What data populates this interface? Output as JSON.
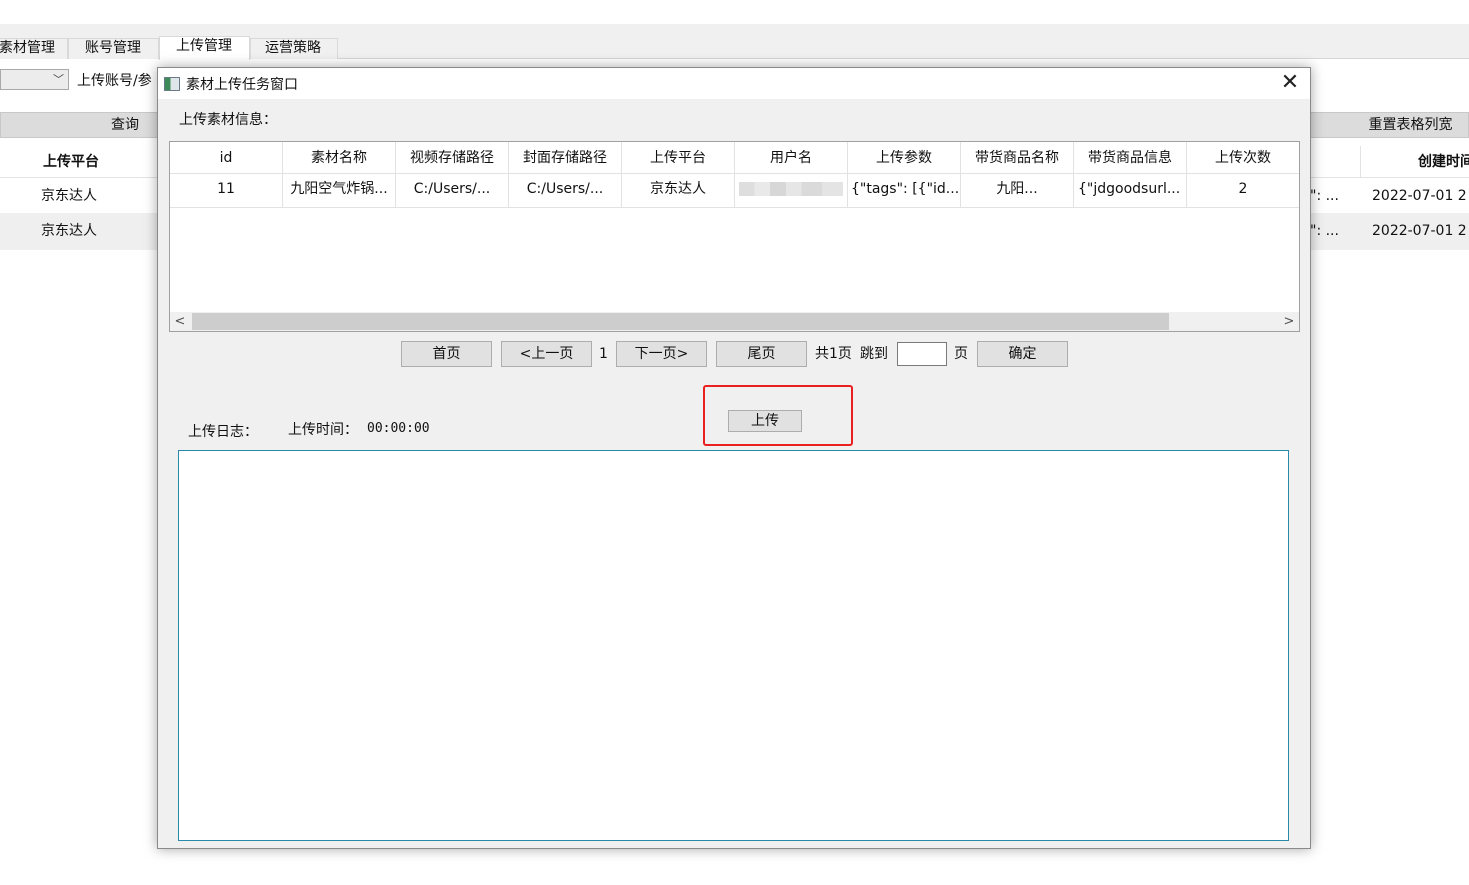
{
  "background": {
    "tabs": [
      "素材管理",
      "账号管理",
      "上传管理",
      "运营策略"
    ],
    "active_tab": "上传管理",
    "filter_label": "上传账号/参",
    "query_button": "查询",
    "reset_columns_button": "重置表格列宽",
    "table": {
      "headers": [
        "上传平台",
        "创建时间"
      ],
      "rows": [
        {
          "platform": "京东达人",
          "params": "\": ...",
          "created": "2022-07-01 2"
        },
        {
          "platform": "京东达人",
          "params": "\": ...",
          "created": "2022-07-01 2"
        }
      ]
    }
  },
  "dialog": {
    "title": "素材上传任务窗口",
    "close_glyph": "✕",
    "info_label": "上传素材信息：",
    "table": {
      "headers": [
        "id",
        "素材名称",
        "视频存储路径",
        "封面存储路径",
        "上传平台",
        "用户名",
        "上传参数",
        "带货商品名称",
        "带货商品信息",
        "上传次数"
      ],
      "rows": [
        [
          "11",
          "九阳空气炸锅...",
          "C:/Users/...",
          "C:/Users/...",
          "京东达人",
          "",
          "{\"tags\": [{\"id...",
          "九阳...",
          "{\"jdgoodsurl...",
          "2"
        ]
      ]
    },
    "pagination": {
      "first": "首页",
      "prev": "<上一页",
      "current_page": "1",
      "next": "下一页>",
      "last": "尾页",
      "total": "共1页",
      "jump_label": "跳到",
      "page_input": "",
      "page_unit": "页",
      "confirm": "确定"
    },
    "upload_button": "上传",
    "log_label": "上传日志：",
    "time_label": "上传时间：",
    "time_value": "00:00:00",
    "log_content": ""
  },
  "colors": {
    "highlight": "#ea1f1f",
    "log_border": "#2a89a8",
    "dialog_bg": "#f0f0f0"
  }
}
